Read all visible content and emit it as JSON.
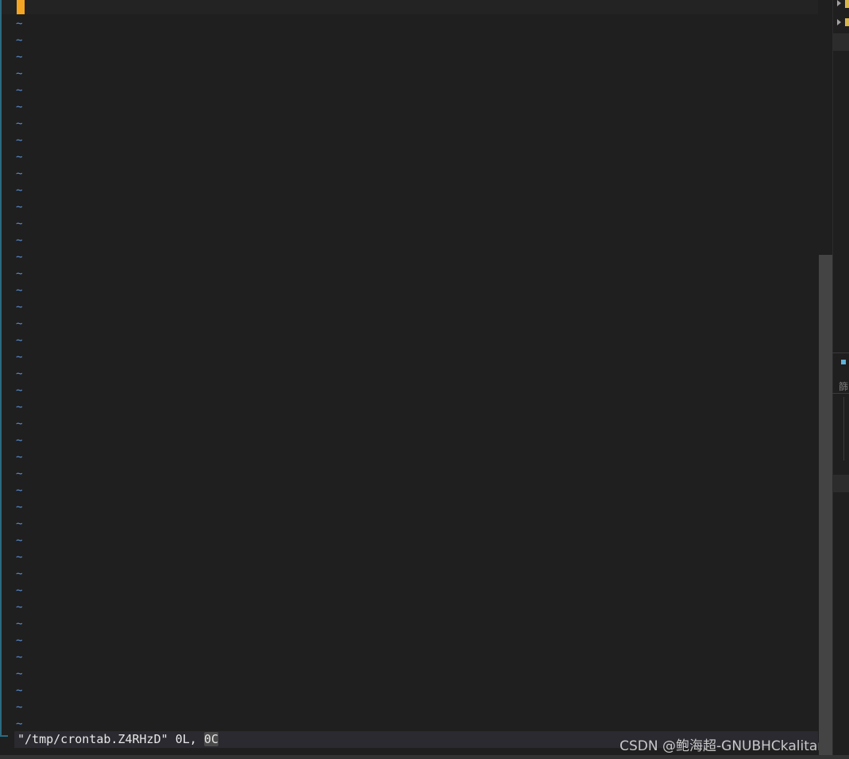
{
  "editor": {
    "empty_line_marker": "~",
    "status_message": {
      "filename": "\"/tmp/crontab.Z4RHzD\"",
      "separator": " ",
      "lines": "0L,",
      "space": " ",
      "chars": "0C"
    }
  },
  "side_panel": {
    "partial_glyph": "篩"
  },
  "watermark": {
    "text": "CSDN @鲍海超-GNUBHCkalitarro"
  },
  "colors": {
    "background": "#1f1f1f",
    "cursor": "#f5a524",
    "tilde": "#5a8fd6",
    "status_bar": "#2a2a30",
    "scroll_thumb": "#444444"
  },
  "icons": {
    "tree_arrow": "chevron-right-icon",
    "folder": "folder-icon",
    "marker": "square-dot-icon"
  }
}
